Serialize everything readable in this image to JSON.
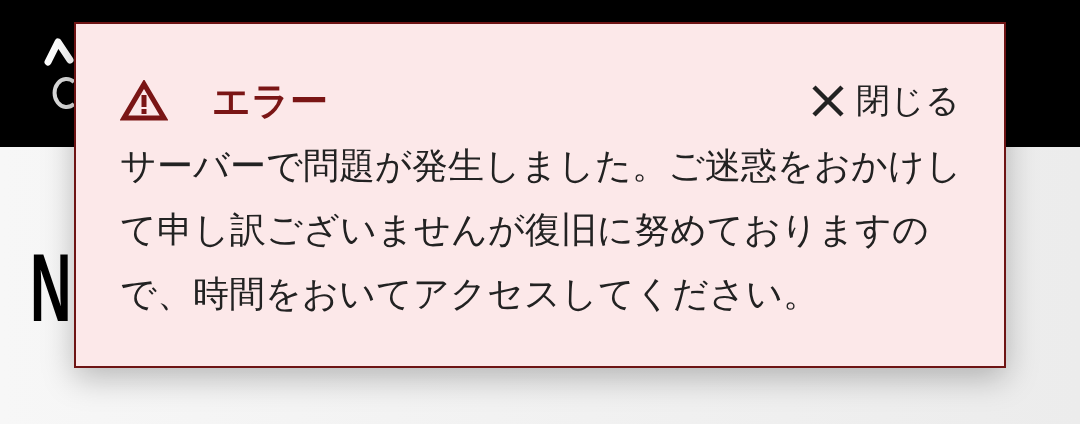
{
  "page": {
    "heading": "N"
  },
  "dialog": {
    "title": "エラー",
    "close_label": "閉じる",
    "message": "サーバーで問題が発生しました。ご迷惑をおかけして申し訳ございませんが復旧に努めておりますので、時間をおいてアクセスしてください。"
  }
}
